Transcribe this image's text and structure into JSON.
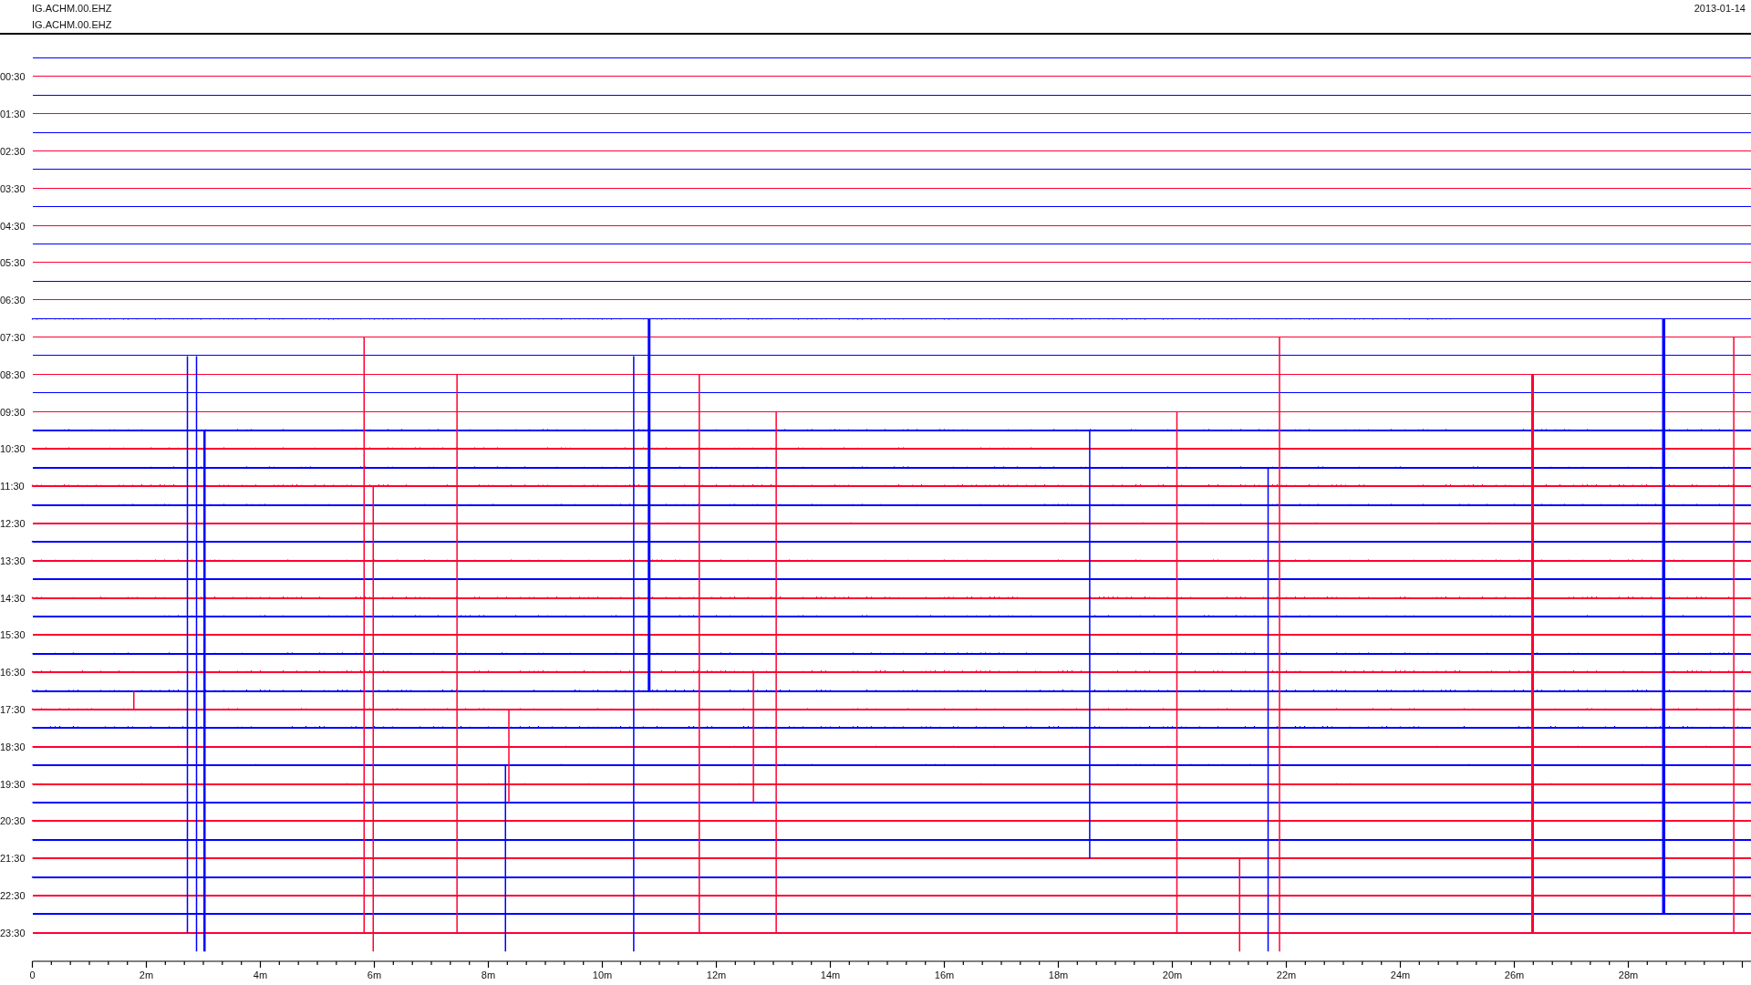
{
  "header": {
    "station_lines": [
      "IG.ACHM.00.EHZ",
      "IG.ACHM.00.EHZ"
    ],
    "date": "2013-01-14"
  },
  "helicorder": {
    "traces": [
      {
        "color": "#0000ff"
      },
      {
        "label": "00:30",
        "color": "#ff0033"
      },
      {
        "color": "#0000ff"
      },
      {
        "label": "01:30",
        "color": "#ff0033"
      },
      {
        "color": "#0000ff"
      },
      {
        "label": "02:30",
        "color": "#ff0033"
      },
      {
        "color": "#0000ff"
      },
      {
        "label": "03:30",
        "color": "#ff0033"
      },
      {
        "color": "#0000ff"
      },
      {
        "label": "04:30",
        "color": "#ff0033"
      },
      {
        "color": "#0000ff"
      },
      {
        "label": "05:30",
        "color": "#ff0033"
      },
      {
        "color": "#0000ff"
      },
      {
        "label": "06:30",
        "color": "#ff0033"
      },
      {
        "color": "#0000ff"
      },
      {
        "label": "07:30",
        "color": "#ff0033"
      },
      {
        "color": "#0000ff"
      },
      {
        "label": "08:30",
        "color": "#ff0033"
      },
      {
        "color": "#0000ff"
      },
      {
        "label": "09:30",
        "color": "#ff0033"
      },
      {
        "color": "#0000ff"
      },
      {
        "label": "10:30",
        "color": "#ff0033"
      },
      {
        "color": "#0000ff"
      },
      {
        "label": "11:30",
        "color": "#ff0033"
      },
      {
        "color": "#0000ff"
      },
      {
        "label": "12:30",
        "color": "#ff0033"
      },
      {
        "color": "#0000ff"
      },
      {
        "label": "13:30",
        "color": "#ff0033"
      },
      {
        "color": "#0000ff"
      },
      {
        "label": "14:30",
        "color": "#ff0033"
      },
      {
        "color": "#0000ff"
      },
      {
        "label": "15:30",
        "color": "#ff0033"
      },
      {
        "color": "#0000ff"
      },
      {
        "label": "16:30",
        "color": "#ff0033"
      },
      {
        "color": "#0000ff"
      },
      {
        "label": "17:30",
        "color": "#ff0033"
      },
      {
        "color": "#0000ff"
      },
      {
        "label": "18:30",
        "color": "#ff0033"
      },
      {
        "color": "#0000ff"
      },
      {
        "label": "19:30",
        "color": "#ff0033"
      },
      {
        "color": "#0000ff"
      },
      {
        "label": "20:30",
        "color": "#ff0033"
      },
      {
        "color": "#0000ff"
      },
      {
        "label": "21:30",
        "color": "#ff0033"
      },
      {
        "color": "#0000ff"
      },
      {
        "label": "22:30",
        "color": "#ff0033"
      },
      {
        "color": "#0000ff"
      },
      {
        "label": "23:30",
        "color": "#ff0033"
      }
    ],
    "x_axis_labels": [
      "0",
      "2m",
      "4m",
      "6m",
      "8m",
      "10m",
      "12m",
      "14m",
      "16m",
      "18m",
      "20m",
      "22m",
      "24m",
      "26m",
      "28m"
    ]
  }
}
